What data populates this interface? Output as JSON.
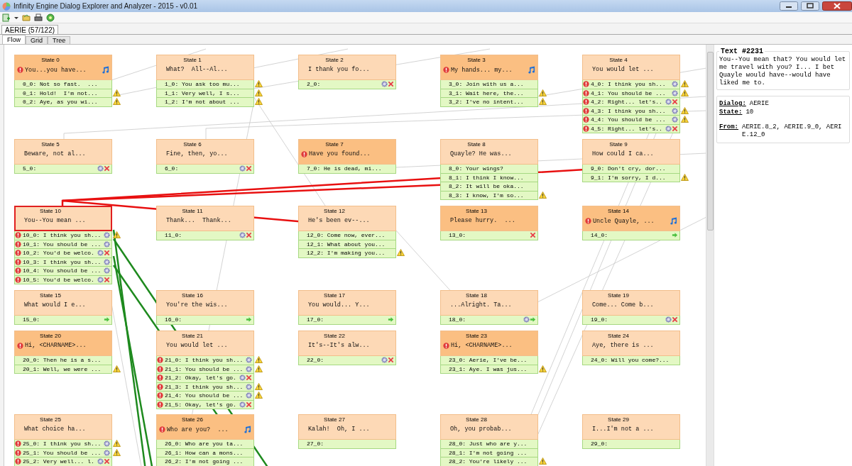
{
  "window": {
    "title": "Infinity Engine Dialog Explorer and Analyzer - 2015 - v0.01"
  },
  "document_tabs": [
    {
      "label": "AERIE (57/122)",
      "selected": true
    }
  ],
  "view_tabs": [
    {
      "label": "Flow",
      "selected": true
    },
    {
      "label": "Grid",
      "selected": false
    },
    {
      "label": "Tree",
      "selected": false
    }
  ],
  "states": [
    {
      "label": "State 0",
      "text": "You...you have...",
      "emphasized": true,
      "alert": true,
      "sound": true,
      "selected": false,
      "transitions": [
        {
          "text": "0_0: Not so fast.  ...",
          "alert": false,
          "action": false,
          "exit": false,
          "next": false,
          "warning": false
        },
        {
          "text": "0_1: Hold!  I'm not...",
          "alert": false,
          "action": false,
          "exit": false,
          "next": false,
          "warning": true
        },
        {
          "text": "0_2: Aye, as you wi...",
          "alert": false,
          "action": false,
          "exit": false,
          "next": false,
          "warning": true
        }
      ]
    },
    {
      "label": "State 1",
      "text": "What?  All--Al...",
      "emphasized": false,
      "alert": false,
      "sound": false,
      "selected": false,
      "transitions": [
        {
          "text": "1_0: You ask too mu...",
          "alert": false,
          "action": false,
          "exit": false,
          "next": false,
          "warning": true
        },
        {
          "text": "1_1: Very well, I s...",
          "alert": false,
          "action": false,
          "exit": false,
          "next": false,
          "warning": true
        },
        {
          "text": "1_2: I'm not about ...",
          "alert": false,
          "action": false,
          "exit": false,
          "next": false,
          "warning": true
        }
      ]
    },
    {
      "label": "State 2",
      "text": "I thank you fo...",
      "emphasized": false,
      "alert": false,
      "sound": false,
      "selected": false,
      "transitions": [
        {
          "text": "2_0:",
          "alert": false,
          "action": true,
          "exit": true,
          "next": false,
          "warning": false
        }
      ]
    },
    {
      "label": "State 3",
      "text": "My hands... my...",
      "emphasized": true,
      "alert": true,
      "sound": true,
      "selected": false,
      "transitions": [
        {
          "text": "3_0: Join with us a...",
          "alert": false,
          "action": false,
          "exit": false,
          "next": false,
          "warning": false
        },
        {
          "text": "3_1: Wait here, the...",
          "alert": false,
          "action": false,
          "exit": false,
          "next": false,
          "warning": true
        },
        {
          "text": "3_2: I've no intent...",
          "alert": false,
          "action": false,
          "exit": false,
          "next": false,
          "warning": true
        }
      ]
    },
    {
      "label": "State 4",
      "text": "You would let ...",
      "emphasized": false,
      "alert": false,
      "sound": false,
      "selected": false,
      "transitions": [
        {
          "text": "4_0: I think you sh...",
          "alert": true,
          "action": true,
          "exit": false,
          "next": false,
          "warning": true
        },
        {
          "text": "4_1: You should be ...",
          "alert": true,
          "action": true,
          "exit": false,
          "next": false,
          "warning": true
        },
        {
          "text": "4_2: Right... let's..",
          "alert": true,
          "action": true,
          "exit": true,
          "next": false,
          "warning": false
        },
        {
          "text": "4_3: I think you sh...",
          "alert": true,
          "action": true,
          "exit": false,
          "next": false,
          "warning": true
        },
        {
          "text": "4_4: You should be ...",
          "alert": true,
          "action": true,
          "exit": false,
          "next": false,
          "warning": true
        },
        {
          "text": "4_5: Right... let's..",
          "alert": true,
          "action": true,
          "exit": true,
          "next": false,
          "warning": false
        }
      ]
    },
    {
      "label": "State 5",
      "text": "Beware, not al...",
      "emphasized": false,
      "alert": false,
      "sound": false,
      "selected": false,
      "transitions": [
        {
          "text": "5_0:",
          "alert": false,
          "action": true,
          "exit": true,
          "next": false,
          "warning": false
        }
      ]
    },
    {
      "label": "State 6",
      "text": "Fine, then, yo...",
      "emphasized": false,
      "alert": false,
      "sound": false,
      "selected": false,
      "transitions": [
        {
          "text": "6_0:",
          "alert": false,
          "action": true,
          "exit": true,
          "next": false,
          "warning": false
        }
      ]
    },
    {
      "label": "State 7",
      "text": "Have you found...",
      "emphasized": true,
      "alert": true,
      "sound": false,
      "selected": false,
      "transitions": [
        {
          "text": "7_0: He is dead, mi...",
          "alert": false,
          "action": false,
          "exit": false,
          "next": false,
          "warning": false
        }
      ]
    },
    {
      "label": "State 8",
      "text": "Quayle? He was...",
      "emphasized": false,
      "alert": false,
      "sound": false,
      "selected": false,
      "transitions": [
        {
          "text": "8_0: Your wings?",
          "alert": false,
          "action": false,
          "exit": false,
          "next": false,
          "warning": false
        },
        {
          "text": "8_1: I think I know...",
          "alert": false,
          "action": false,
          "exit": false,
          "next": false,
          "warning": false
        },
        {
          "text": "8_2: It will be oka...",
          "alert": false,
          "action": false,
          "exit": false,
          "next": false,
          "warning": false
        },
        {
          "text": "8_3: I know, I'm so...",
          "alert": false,
          "action": false,
          "exit": false,
          "next": false,
          "warning": true
        }
      ]
    },
    {
      "label": "State 9",
      "text": "How could I ca...",
      "emphasized": false,
      "alert": false,
      "sound": false,
      "selected": false,
      "transitions": [
        {
          "text": "9_0: Don't cry, dor...",
          "alert": false,
          "action": false,
          "exit": false,
          "next": false,
          "warning": false
        },
        {
          "text": "9_1: I'm sorry, I d...",
          "alert": false,
          "action": false,
          "exit": false,
          "next": false,
          "warning": true
        }
      ]
    },
    {
      "label": "State 10",
      "text": "You--You mean ...",
      "emphasized": false,
      "alert": false,
      "sound": false,
      "selected": true,
      "transitions": [
        {
          "text": "10_0: I think you sh...",
          "alert": true,
          "action": true,
          "exit": false,
          "next": false,
          "warning": true
        },
        {
          "text": "10_1: You should be ...",
          "alert": true,
          "action": true,
          "exit": false,
          "next": false,
          "warning": false
        },
        {
          "text": "10_2: You'd be welco.",
          "alert": true,
          "action": true,
          "exit": true,
          "next": false,
          "warning": false
        },
        {
          "text": "10_3: I think you sh...",
          "alert": true,
          "action": true,
          "exit": false,
          "next": false,
          "warning": false
        },
        {
          "text": "10_4: You should be ...",
          "alert": true,
          "action": true,
          "exit": false,
          "next": false,
          "warning": false
        },
        {
          "text": "10_5: You'd be welco.",
          "alert": true,
          "action": true,
          "exit": true,
          "next": false,
          "warning": false
        }
      ]
    },
    {
      "label": "State 11",
      "text": "Thank...  Thank...",
      "emphasized": false,
      "alert": false,
      "sound": false,
      "selected": false,
      "transitions": [
        {
          "text": "11_0:",
          "alert": false,
          "action": true,
          "exit": true,
          "next": false,
          "warning": false
        }
      ]
    },
    {
      "label": "State 12",
      "text": "He's been ev--...",
      "emphasized": false,
      "alert": false,
      "sound": false,
      "selected": false,
      "transitions": [
        {
          "text": "12_0: Come now, ever...",
          "alert": false,
          "action": false,
          "exit": false,
          "next": false,
          "warning": false
        },
        {
          "text": "12_1: What about you...",
          "alert": false,
          "action": false,
          "exit": false,
          "next": false,
          "warning": false
        },
        {
          "text": "12_2: I'm making you...",
          "alert": false,
          "action": false,
          "exit": false,
          "next": false,
          "warning": true
        }
      ]
    },
    {
      "label": "State 13",
      "text": "Please hurry.  ...",
      "emphasized": true,
      "alert": false,
      "sound": false,
      "selected": false,
      "transitions": [
        {
          "text": "13_0:",
          "alert": false,
          "action": false,
          "exit": true,
          "next": false,
          "warning": false
        }
      ]
    },
    {
      "label": "State 14",
      "text": "Uncle Quayle, ...",
      "emphasized": true,
      "alert": true,
      "sound": true,
      "selected": false,
      "transitions": [
        {
          "text": "14_0:",
          "alert": false,
          "action": false,
          "exit": false,
          "next": true,
          "warning": false
        }
      ]
    },
    {
      "label": "State 15",
      "text": "What would I e...",
      "emphasized": false,
      "alert": false,
      "sound": false,
      "selected": false,
      "transitions": [
        {
          "text": "15_0:",
          "alert": false,
          "action": false,
          "exit": false,
          "next": true,
          "warning": false
        }
      ]
    },
    {
      "label": "State 16",
      "text": "You're the wis...",
      "emphasized": false,
      "alert": false,
      "sound": false,
      "selected": false,
      "transitions": [
        {
          "text": "16_0:",
          "alert": false,
          "action": false,
          "exit": false,
          "next": true,
          "warning": false
        }
      ]
    },
    {
      "label": "State 17",
      "text": "You would... Y...",
      "emphasized": false,
      "alert": false,
      "sound": false,
      "selected": false,
      "transitions": [
        {
          "text": "17_0:",
          "alert": false,
          "action": false,
          "exit": false,
          "next": true,
          "warning": false
        }
      ]
    },
    {
      "label": "State 18",
      "text": "...Alright. Ta...",
      "emphasized": false,
      "alert": false,
      "sound": false,
      "selected": false,
      "transitions": [
        {
          "text": "18_0:",
          "alert": false,
          "action": true,
          "exit": false,
          "next": true,
          "warning": false
        }
      ]
    },
    {
      "label": "State 19",
      "text": "Come... Come b...",
      "emphasized": false,
      "alert": false,
      "sound": false,
      "selected": false,
      "transitions": [
        {
          "text": "19_0:",
          "alert": false,
          "action": true,
          "exit": true,
          "next": false,
          "warning": false
        }
      ]
    },
    {
      "label": "State 20",
      "text": "Hi, <CHARNAME>...",
      "emphasized": true,
      "alert": true,
      "sound": false,
      "selected": false,
      "transitions": [
        {
          "text": "20_0: Then he is a s...",
          "alert": false,
          "action": false,
          "exit": false,
          "next": false,
          "warning": false
        },
        {
          "text": "20_1: Well, we were ...",
          "alert": false,
          "action": false,
          "exit": false,
          "next": false,
          "warning": true
        }
      ]
    },
    {
      "label": "State 21",
      "text": "You would let ...",
      "emphasized": false,
      "alert": false,
      "sound": false,
      "selected": false,
      "transitions": [
        {
          "text": "21_0: I think you sh...",
          "alert": true,
          "action": true,
          "exit": false,
          "next": false,
          "warning": true
        },
        {
          "text": "21_1: You should be ...",
          "alert": true,
          "action": true,
          "exit": false,
          "next": false,
          "warning": true
        },
        {
          "text": "21_2: Okay, let's go.",
          "alert": true,
          "action": true,
          "exit": true,
          "next": false,
          "warning": false
        },
        {
          "text": "21_3: I think you sh...",
          "alert": true,
          "action": true,
          "exit": false,
          "next": false,
          "warning": true
        },
        {
          "text": "21_4: You should be ...",
          "alert": true,
          "action": true,
          "exit": false,
          "next": false,
          "warning": true
        },
        {
          "text": "21_5: Okay, let's go.",
          "alert": true,
          "action": true,
          "exit": true,
          "next": false,
          "warning": false
        }
      ]
    },
    {
      "label": "State 22",
      "text": "It's--It's alw...",
      "emphasized": false,
      "alert": false,
      "sound": false,
      "selected": false,
      "transitions": [
        {
          "text": "22_0:",
          "alert": false,
          "action": true,
          "exit": true,
          "next": false,
          "warning": false
        }
      ]
    },
    {
      "label": "State 23",
      "text": "Hi, <CHARNAME>...",
      "emphasized": true,
      "alert": true,
      "sound": false,
      "selected": false,
      "transitions": [
        {
          "text": "23_0: Aerie, I've be...",
          "alert": false,
          "action": false,
          "exit": false,
          "next": false,
          "warning": false
        },
        {
          "text": "23_1: Aye. I was jus...",
          "alert": false,
          "action": false,
          "exit": false,
          "next": false,
          "warning": true
        }
      ]
    },
    {
      "label": "State 24",
      "text": "Aye, there is ...",
      "emphasized": false,
      "alert": false,
      "sound": false,
      "selected": false,
      "transitions": [
        {
          "text": "24_0: Will you come?...",
          "alert": false,
          "action": false,
          "exit": false,
          "next": false,
          "warning": false
        }
      ]
    },
    {
      "label": "State 25",
      "text": "What choice ha...",
      "emphasized": false,
      "alert": false,
      "sound": false,
      "selected": false,
      "transitions": [
        {
          "text": "25_0: I think you sh...",
          "alert": true,
          "action": true,
          "exit": false,
          "next": false,
          "warning": true
        },
        {
          "text": "25_1: You should be ...",
          "alert": true,
          "action": true,
          "exit": false,
          "next": false,
          "warning": true
        },
        {
          "text": "25_2: Very well... l.",
          "alert": true,
          "action": true,
          "exit": true,
          "next": false,
          "warning": false
        }
      ]
    },
    {
      "label": "State 26",
      "text": "Who are you?  ...",
      "emphasized": true,
      "alert": true,
      "sound": true,
      "selected": false,
      "transitions": [
        {
          "text": "26_0: Who are you ta...",
          "alert": false,
          "action": false,
          "exit": false,
          "next": false,
          "warning": false
        },
        {
          "text": "26_1: How can a mons...",
          "alert": false,
          "action": false,
          "exit": false,
          "next": false,
          "warning": false
        },
        {
          "text": "26_2: I'm not going ...",
          "alert": false,
          "action": false,
          "exit": false,
          "next": false,
          "warning": false
        }
      ]
    },
    {
      "label": "State 27",
      "text": "Kalah!  Oh, I ...",
      "emphasized": false,
      "alert": false,
      "sound": false,
      "selected": false,
      "transitions": [
        {
          "text": "27_0:",
          "alert": false,
          "action": false,
          "exit": false,
          "next": false,
          "warning": false
        }
      ]
    },
    {
      "label": "State 28",
      "text": "Oh, you probab...",
      "emphasized": false,
      "alert": false,
      "sound": false,
      "selected": false,
      "transitions": [
        {
          "text": "28_0: Just who are y...",
          "alert": false,
          "action": false,
          "exit": false,
          "next": false,
          "warning": false
        },
        {
          "text": "28_1: I'm not going ...",
          "alert": false,
          "action": false,
          "exit": false,
          "next": false,
          "warning": false
        },
        {
          "text": "28_2: You're likely ...",
          "alert": false,
          "action": false,
          "exit": false,
          "next": false,
          "warning": true
        }
      ]
    },
    {
      "label": "State 29",
      "text": "I...I'm not a ...",
      "emphasized": false,
      "alert": false,
      "sound": false,
      "selected": false,
      "transitions": [
        {
          "text": "29_0:",
          "alert": false,
          "action": false,
          "exit": false,
          "next": false,
          "warning": false
        }
      ]
    }
  ],
  "details": {
    "title": "Text #2231",
    "text": "You--You mean that? You would let me travel with you? I... I bet Quayle would have--would have liked me to.",
    "fields": [
      {
        "label": "Dialog:",
        "value": "AERIE"
      },
      {
        "label": "State:",
        "value": "10"
      },
      {
        "label": "From:",
        "value": "AERIE.8_2, AERIE.9_0, AERIE.12_0"
      }
    ]
  }
}
